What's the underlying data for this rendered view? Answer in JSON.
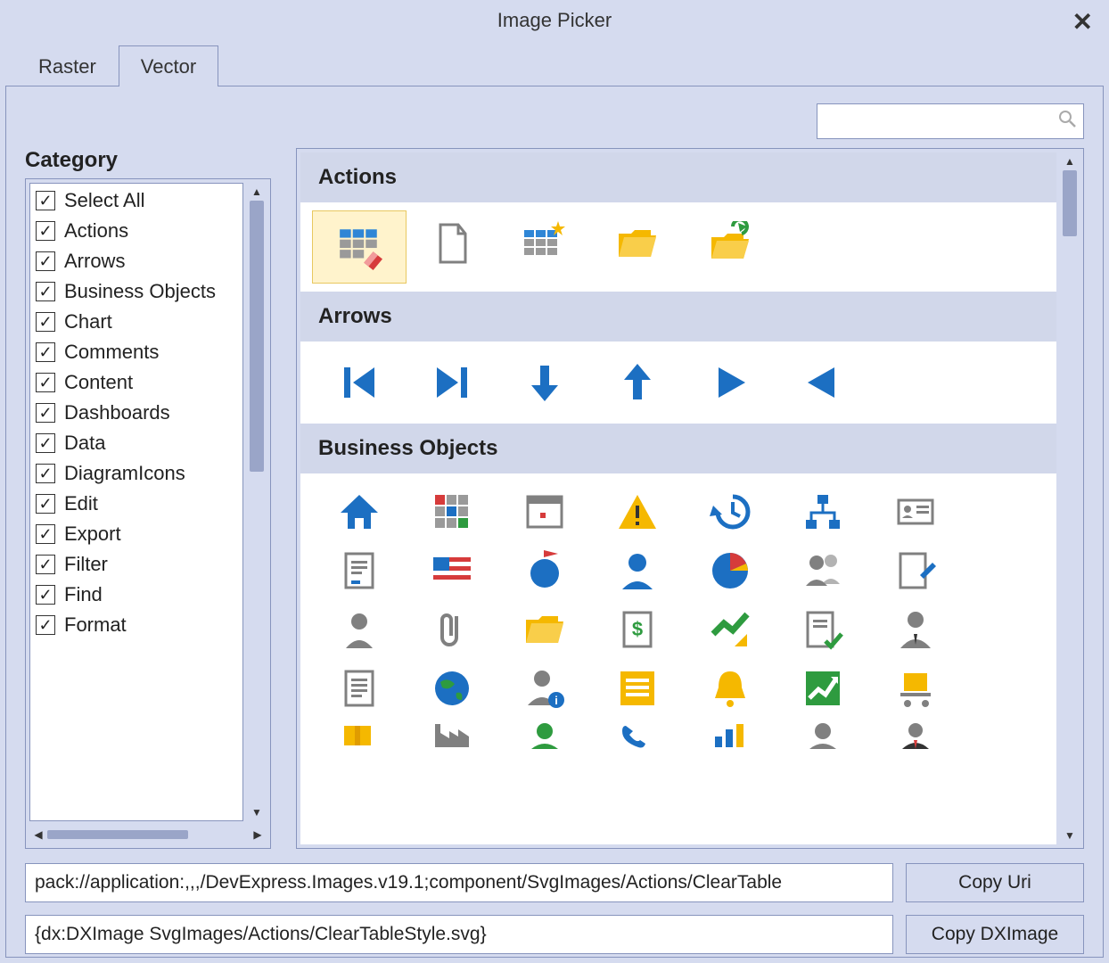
{
  "window": {
    "title": "Image Picker"
  },
  "tabs": {
    "raster": "Raster",
    "vector": "Vector",
    "active": "vector"
  },
  "search": {
    "placeholder": ""
  },
  "sidebar": {
    "title": "Category",
    "items": [
      {
        "label": "Select All",
        "checked": true
      },
      {
        "label": "Actions",
        "checked": true
      },
      {
        "label": "Arrows",
        "checked": true
      },
      {
        "label": "Business Objects",
        "checked": true
      },
      {
        "label": "Chart",
        "checked": true
      },
      {
        "label": "Comments",
        "checked": true
      },
      {
        "label": "Content",
        "checked": true
      },
      {
        "label": "Dashboards",
        "checked": true
      },
      {
        "label": "Data",
        "checked": true
      },
      {
        "label": "DiagramIcons",
        "checked": true
      },
      {
        "label": "Edit",
        "checked": true
      },
      {
        "label": "Export",
        "checked": true
      },
      {
        "label": "Filter",
        "checked": true
      },
      {
        "label": "Find",
        "checked": true
      },
      {
        "label": "Format",
        "checked": true
      }
    ]
  },
  "groups": {
    "g0": "Actions",
    "g1": "Arrows",
    "g2": "Business Objects"
  },
  "gallery": {
    "actions": [
      {
        "name": "clear-table-style",
        "selected": true
      },
      {
        "name": "new-document"
      },
      {
        "name": "new-table-style"
      },
      {
        "name": "open-folder"
      },
      {
        "name": "refresh-folder"
      }
    ],
    "arrows": [
      {
        "name": "first"
      },
      {
        "name": "last"
      },
      {
        "name": "down"
      },
      {
        "name": "up"
      },
      {
        "name": "play"
      },
      {
        "name": "prev"
      }
    ],
    "business": [
      {
        "name": "home"
      },
      {
        "name": "color-grid"
      },
      {
        "name": "calendar"
      },
      {
        "name": "warning"
      },
      {
        "name": "history"
      },
      {
        "name": "org-chart"
      },
      {
        "name": "id-card"
      },
      {
        "name": "notes"
      },
      {
        "name": "usa-flag"
      },
      {
        "name": "flag-globe"
      },
      {
        "name": "user"
      },
      {
        "name": "pie-chart"
      },
      {
        "name": "users"
      },
      {
        "name": "edit-note"
      },
      {
        "name": "contact"
      },
      {
        "name": "attachment"
      },
      {
        "name": "folder"
      },
      {
        "name": "currency"
      },
      {
        "name": "chart-check"
      },
      {
        "name": "doc-check"
      },
      {
        "name": "business-user"
      },
      {
        "name": "document"
      },
      {
        "name": "globe"
      },
      {
        "name": "user-info"
      },
      {
        "name": "list"
      },
      {
        "name": "bell"
      },
      {
        "name": "trend"
      },
      {
        "name": "cart"
      },
      {
        "name": "package"
      },
      {
        "name": "factory"
      },
      {
        "name": "user-green"
      },
      {
        "name": "phone"
      },
      {
        "name": "bar-chart"
      },
      {
        "name": "user-gray"
      },
      {
        "name": "suit-user"
      }
    ]
  },
  "footer": {
    "uri": "pack://application:,,,/DevExpress.Images.v19.1;component/SvgImages/Actions/ClearTable",
    "dximage": "{dx:DXImage SvgImages/Actions/ClearTableStyle.svg}",
    "copy_uri": "Copy Uri",
    "copy_dximage": "Copy DXImage"
  }
}
